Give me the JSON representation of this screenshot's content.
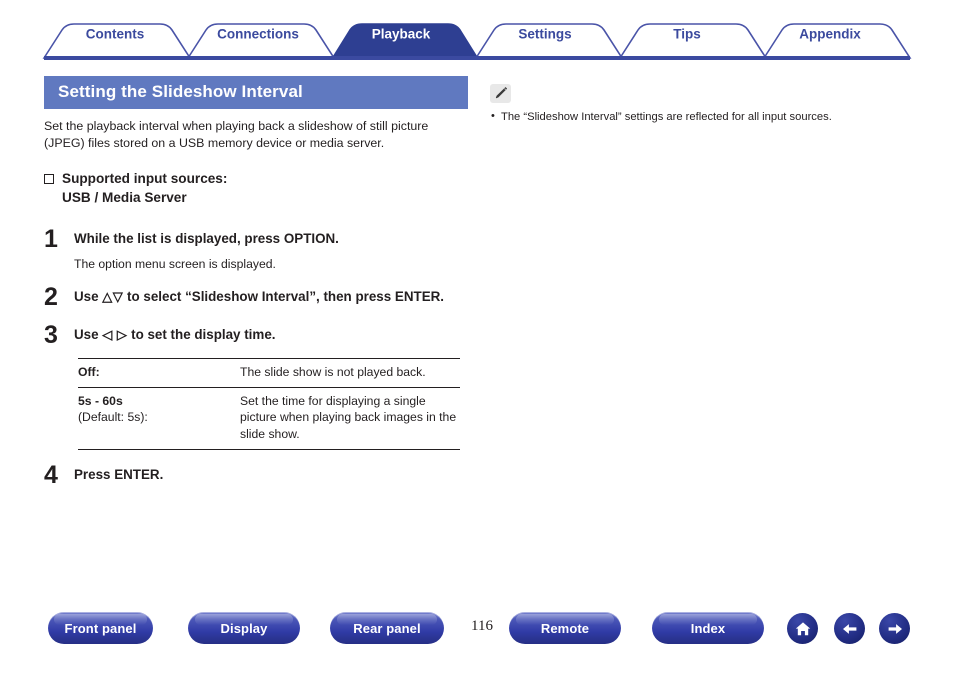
{
  "tabs": [
    {
      "label": "Contents",
      "active": false
    },
    {
      "label": "Connections",
      "active": false
    },
    {
      "label": "Playback",
      "active": true
    },
    {
      "label": "Settings",
      "active": false
    },
    {
      "label": "Tips",
      "active": false
    },
    {
      "label": "Appendix",
      "active": false
    }
  ],
  "section": {
    "title": "Setting the Slideshow Interval",
    "intro": "Set the playback interval when playing back a slideshow of still picture (JPEG) files stored on a USB memory device or media server."
  },
  "supported": {
    "heading": "Supported input sources:",
    "value": "USB / Media Server"
  },
  "steps": [
    {
      "num": "1",
      "head": "While the list is displayed, press OPTION.",
      "sub": "The option menu screen is displayed."
    },
    {
      "num": "2",
      "head_pre": "Use ",
      "head_glyph": "△▽",
      "head_post": " to select “Slideshow Interval”, then press ENTER.",
      "sub": ""
    },
    {
      "num": "3",
      "head_pre": "Use ",
      "head_glyph": "◁ ▷",
      "head_post": " to set the display time.",
      "sub": ""
    },
    {
      "num": "4",
      "head": "Press ENTER.",
      "sub": ""
    }
  ],
  "option_table": {
    "rows": [
      {
        "key": "Off:",
        "key_sub": "",
        "value": "The slide show is not played back."
      },
      {
        "key": "5s - 60s",
        "key_sub": "(Default: 5s):",
        "value": "Set the time for displaying a single picture when playing back images in the slide show."
      }
    ]
  },
  "note": {
    "icon": "pencil-icon",
    "items": [
      "The “Slideshow Interval” settings are reflected for all input sources."
    ]
  },
  "footer": {
    "buttons": [
      {
        "label": "Front panel"
      },
      {
        "label": "Display"
      },
      {
        "label": "Rear panel"
      },
      {
        "label": "Remote"
      },
      {
        "label": "Index"
      }
    ],
    "page_number": "116",
    "icons": [
      {
        "name": "home-icon"
      },
      {
        "name": "arrow-left-icon"
      },
      {
        "name": "arrow-right-icon"
      }
    ]
  },
  "colors": {
    "tab_active_bg": "#2e3f92",
    "tab_outline": "#4a54a8",
    "title_bar_bg": "#6079c0",
    "rule": "#3b4aa0",
    "text": "#231f20"
  }
}
